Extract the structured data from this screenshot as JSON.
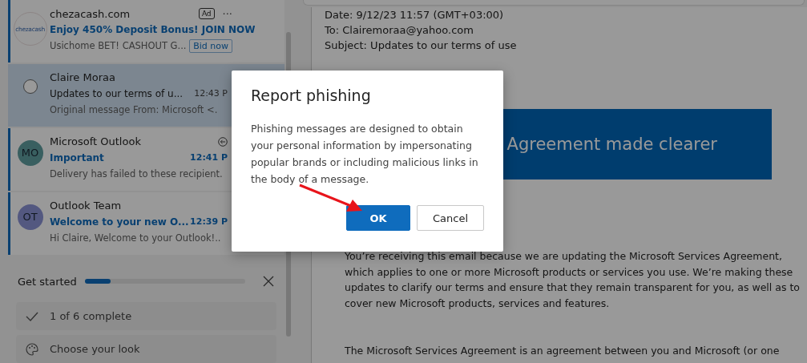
{
  "mail_list": [
    {
      "kind": "ad",
      "logo_text": "chezacash",
      "sender": "chezacash.com",
      "badge": "Ad",
      "more": "···",
      "subject": "Enjoy 450% Deposit Bonus! JOIN NOW",
      "preview": "Usichome BET! CASHOUT G...",
      "action": "Bid now",
      "selected": false,
      "unread": true
    },
    {
      "kind": "message",
      "sender": "Claire Moraa",
      "subject": "Updates to our terms of u...",
      "time": "12:43 P",
      "preview": "Original message From: Microsoft <.",
      "selected": true,
      "unread": false
    },
    {
      "kind": "message",
      "initials": "MO",
      "color": "#395f60",
      "sender": "Microsoft Outlook",
      "subject": "Important",
      "time": "12:41 P",
      "preview": "Delivery has failed to these recipient.",
      "selected": false,
      "unread": true,
      "replied": true
    },
    {
      "kind": "message",
      "initials": "OT",
      "color": "#535880",
      "sender": "Outlook Team",
      "subject": "Welcome to your new O...",
      "time": "12:39 P",
      "preview": "Hi Claire, Welcome to your Outlook!..",
      "selected": false,
      "unread": true
    }
  ],
  "get_started": {
    "title": "Get started",
    "level": 0.16,
    "steps": [
      {
        "kind": "check",
        "label": "1 of 6 complete"
      },
      {
        "kind": "palette",
        "label": "Choose your look"
      }
    ]
  },
  "reading_pane": {
    "header_lines": [
      "Date: 9/12/23 11:57 (GMT+03:00)",
      "To: Clairemoraa@yahoo.com",
      "Subject: Updates to our terms of use"
    ],
    "banner": "Agreement made clearer",
    "paragraphs": [
      "You’re receiving this email because we are updating the Microsoft Services Agreement, which applies to one or more Microsoft products or services you use. We’re making these updates to clarify our terms and ensure that they remain transparent for you, as well as to cover new Microsoft products, services and features.",
      "The Microsoft Services Agreement is an agreement between you and Microsoft (or one"
    ]
  },
  "dialog": {
    "title": "Report phishing",
    "message": "Phishing messages are designed to obtain your personal information by impersonating popular brands or including malicious links in the body of a message.",
    "buttons": [
      {
        "label": "OK",
        "primary": true
      },
      {
        "label": "Cancel",
        "primary": false
      }
    ]
  }
}
